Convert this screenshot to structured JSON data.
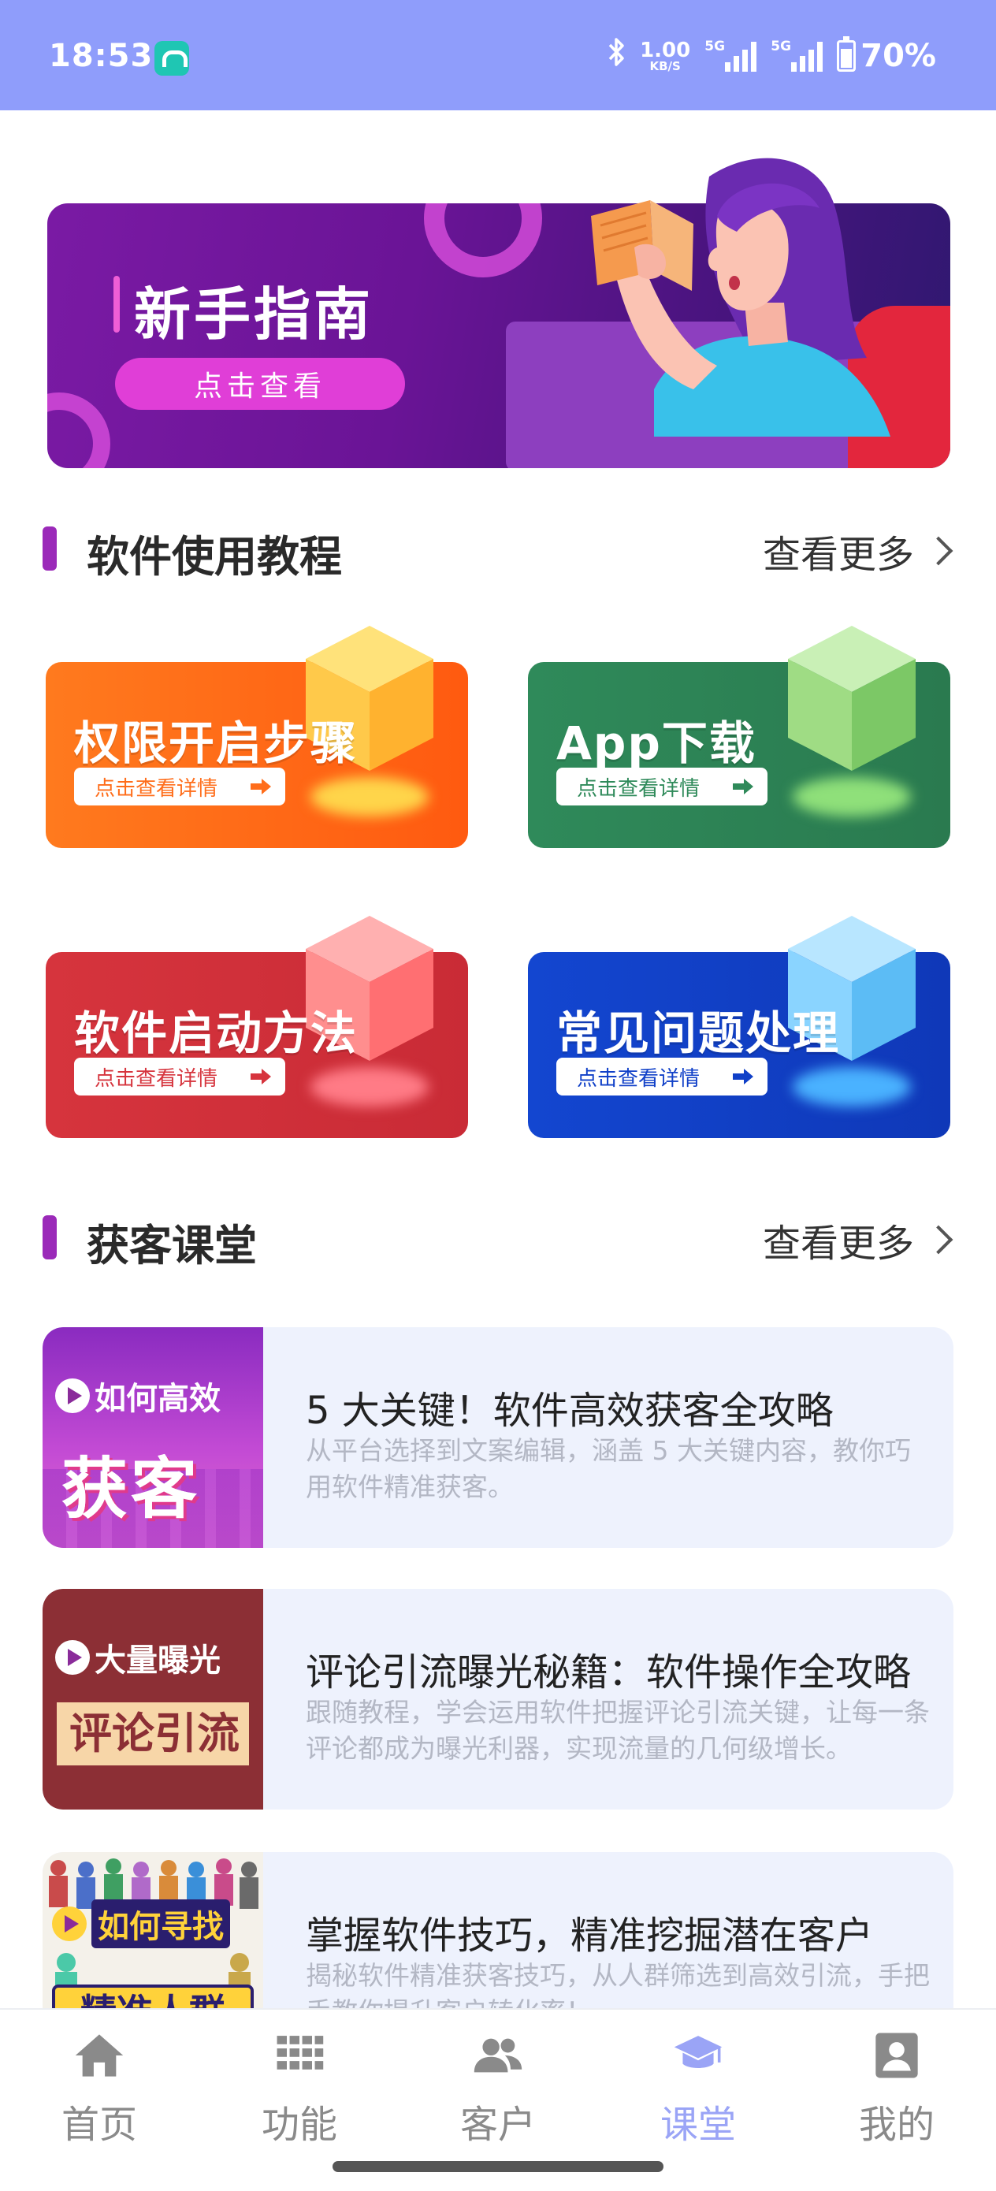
{
  "status_bar": {
    "time": "18:53",
    "net_speed_value": "1.00",
    "net_speed_unit": "KB/S",
    "signal1_tag": "5G",
    "signal2_tag": "5G",
    "battery": "70%",
    "icons": [
      "app-icon",
      "bluetooth-icon",
      "signal-icon",
      "signal-icon",
      "battery-icon"
    ]
  },
  "hero": {
    "title": "新手指南",
    "button": "点击查看",
    "colors": {
      "background": "#6a1496",
      "button": "#e03ed7"
    }
  },
  "tutorials": {
    "title": "软件使用教程",
    "more": "查看更多",
    "cards": [
      {
        "title": "权限开启步骤",
        "action": "点击查看详情",
        "color": "#ff6d1a"
      },
      {
        "title": "App下载",
        "action": "点击查看详情",
        "color": "#2f8a5a"
      },
      {
        "title": "软件启动方法",
        "action": "点击查看详情",
        "color": "#d6343d"
      },
      {
        "title": "常见问题处理",
        "action": "点击查看详情",
        "color": "#1040c8"
      }
    ]
  },
  "classroom": {
    "title": "获客课堂",
    "more": "查看更多",
    "items": [
      {
        "thumb_top": "如何高效",
        "thumb_big": "获客",
        "title": "5 大关键！软件高效获客全攻略",
        "desc": "从平台选择到文案编辑，涵盖 5 大关键内容，教你巧用软件精准获客。"
      },
      {
        "thumb_top": "大量曝光",
        "thumb_big": "评论引流",
        "title": "评论引流曝光秘籍：软件操作全攻略",
        "desc": "跟随教程，学会运用软件把握评论引流关键，让每一条评论都成为曝光利器，实现流量的几何级增长。"
      },
      {
        "thumb_top": "如何寻找",
        "thumb_big": "精准人群",
        "title": "掌握软件技巧，精准挖掘潜在客户",
        "desc": "揭秘软件精准获客技巧，从人群筛选到高效引流，手把手教你提升客户转化率！"
      }
    ]
  },
  "bottom_nav": {
    "items": [
      {
        "label": "首页",
        "icon": "home-icon"
      },
      {
        "label": "功能",
        "icon": "grid-icon"
      },
      {
        "label": "客户",
        "icon": "users-icon"
      },
      {
        "label": "课堂",
        "icon": "graduation-cap-icon",
        "active": true
      },
      {
        "label": "我的",
        "icon": "profile-icon"
      }
    ],
    "active_color": "#9aa4f6"
  }
}
